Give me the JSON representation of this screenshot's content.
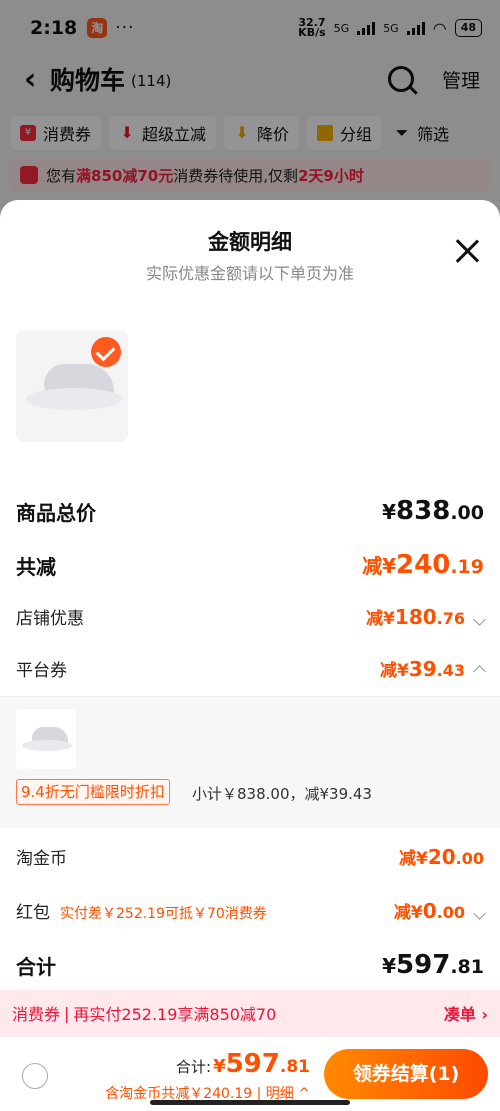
{
  "status_bar": {
    "time": "2:18",
    "app_badge": "淘",
    "dots": "···",
    "net_speed_value": "32.7",
    "net_speed_unit": "KB/s",
    "network_1": "5G",
    "network_2": "5G",
    "battery": "48"
  },
  "nav": {
    "back": "‹",
    "title": "购物车",
    "count": "(114)",
    "manage": "管理"
  },
  "filters": [
    {
      "label": "消费券"
    },
    {
      "label": "超级立减"
    },
    {
      "label": "降价"
    },
    {
      "label": "分组"
    },
    {
      "label": "筛选"
    }
  ],
  "coupon_bar": {
    "prefix": "您有",
    "highlight": "满850减70元",
    "middle": "消费券待使用,仅剩",
    "time_left": "2天9小时"
  },
  "sheet": {
    "title": "金额明细",
    "subtitle": "实际优惠金额请以下单页为准",
    "rows": {
      "total": {
        "label": "商品总价",
        "yen": "¥",
        "int": "838",
        "dec": ".00"
      },
      "reduce": {
        "label": "共减",
        "pre": "减¥",
        "int": "240",
        "dec": ".19"
      },
      "shop": {
        "label": "店铺优惠",
        "pre": "减¥",
        "int": "180",
        "dec": ".76"
      },
      "platform": {
        "label": "平台券",
        "pre": "减¥",
        "int": "39",
        "dec": ".43"
      },
      "coins": {
        "label": "淘金币",
        "pre": "减¥",
        "int": "20",
        "dec": ".00"
      },
      "redpack": {
        "label": "红包",
        "note": "实付差￥252.19可抵￥70消费券",
        "pre": "减¥",
        "int": "0",
        "dec": ".00"
      },
      "sum": {
        "label": "合计",
        "yen": "¥",
        "int": "597",
        "dec": ".81"
      }
    },
    "detail": {
      "tag": "9.4折无门槛限时折扣",
      "subtotal": "小计￥838.00，减¥39.43"
    }
  },
  "promo": {
    "label": "消费券",
    "sep": "|",
    "text": "再实付252.19享满850减70",
    "action": "凑单 ›"
  },
  "footer": {
    "sum_label": "合计:",
    "pre": "¥",
    "int": "597",
    "dec": ".81",
    "deduct": "含淘金币共减￥240.19 | 明细 ^",
    "checkout": "领券结算(1)"
  },
  "colors": {
    "accent": "#ff5000",
    "coupon_red": "#ff1f3d",
    "checkout_start": "#ff8a00",
    "checkout_end": "#ff4a00"
  }
}
